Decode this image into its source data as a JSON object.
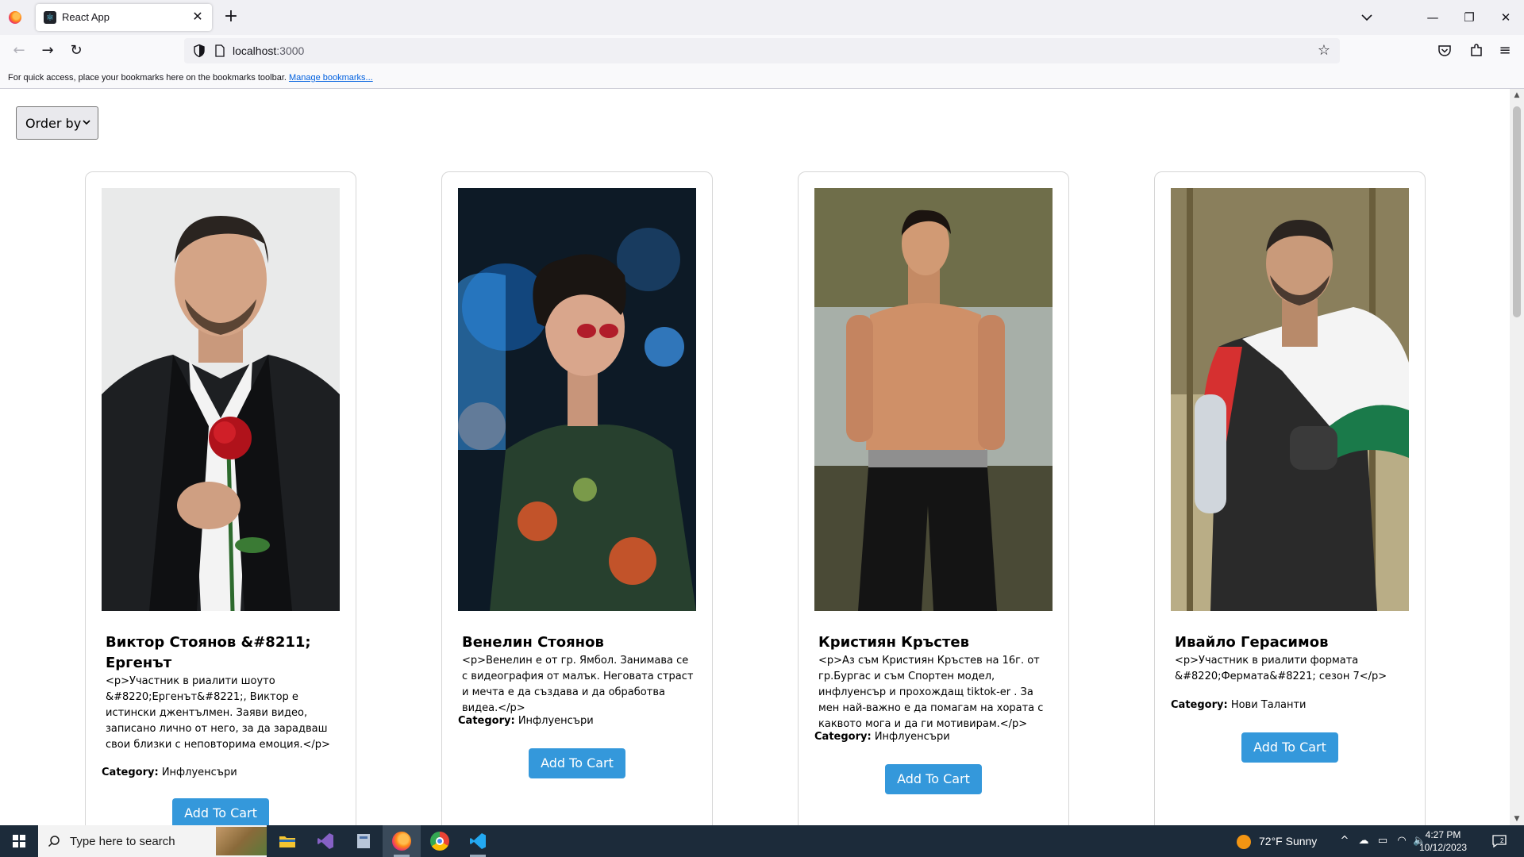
{
  "browser": {
    "tab_title": "React App",
    "url_host": "localhost",
    "url_port": ":3000",
    "bookmarks_message": "For quick access, place your bookmarks here on the bookmarks toolbar.",
    "bookmarks_link": "Manage bookmarks..."
  },
  "page": {
    "order_by_label": "Order by",
    "category_label": "Category:",
    "cards": [
      {
        "name": "Виктор Стоянов &#8211; Ергенът",
        "description": "<p>Участник в риалити шоуто &#8220;Ергенът&#8221;, Виктор е истински джентълмен. Заяви видео, записано лично от него, за да зарадваш свои близки с неповторима емоция.</p>",
        "category": "Инфлуенсъри",
        "button": "Add To Cart"
      },
      {
        "name": "Венелин Стоянов",
        "description": "<p>Венелин е от гр. Ямбол. Занимава се с видеография от малък. Неговата страст и мечта е да създава и да обработва видеа.</p>",
        "category": "Инфлуенсъри",
        "button": "Add To Cart"
      },
      {
        "name": "Кристиян Кръстев",
        "description": "<p>Аз съм Кристиян Кръстев на 16г. от гр.Бургас и съм Спортен модел, инфлуенсър и прохождащ tiktok-er . За мен най-важно е да помагам на хората с каквото мога и да ги мотивирам.</p>",
        "category": "Инфлуенсъри",
        "button": "Add To Cart"
      },
      {
        "name": "Ивайло Герасимов",
        "description": "<p>Участник в риалити формата &#8220;Фермата&#8221; сезон 7</p>",
        "category": "Нови Таланти",
        "button": "Add To Cart"
      }
    ]
  },
  "taskbar": {
    "search_placeholder": "Type here to search",
    "weather": "72°F  Sunny",
    "time": "4:27 PM",
    "date": "10/12/2023",
    "notification_count": "2"
  },
  "colors": {
    "button_blue": "#3498db",
    "taskbar": "#1c2b3a"
  }
}
